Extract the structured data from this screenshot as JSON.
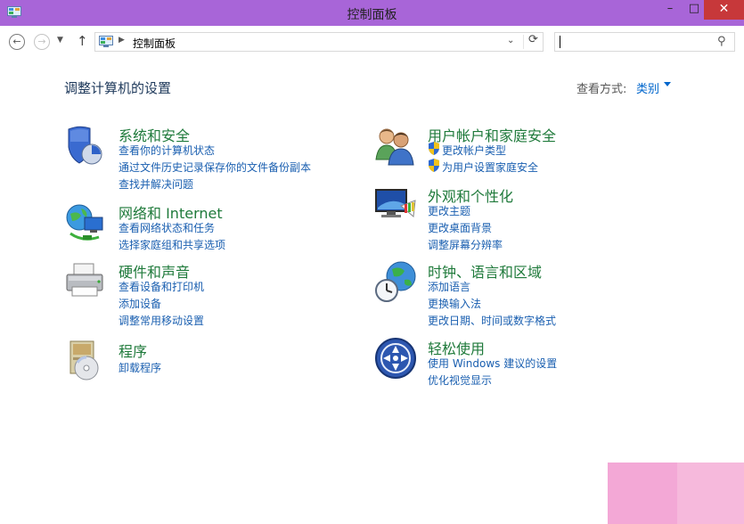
{
  "window": {
    "title": "控制面板"
  },
  "toolbar": {
    "address_path": "控制面板",
    "search_placeholder": ""
  },
  "main": {
    "heading": "调整计算机的设置",
    "view_by_label": "查看方式:",
    "view_by_value": "类别"
  },
  "categories": [
    {
      "title": "系统和安全",
      "icon": "shield-icon",
      "links": [
        "查看你的计算机状态",
        "通过文件历史记录保存你的文件备份副本",
        "查找并解决问题"
      ]
    },
    {
      "title": "网络和 Internet",
      "icon": "network-globe-icon",
      "links": [
        "查看网络状态和任务",
        "选择家庭组和共享选项"
      ]
    },
    {
      "title": "硬件和声音",
      "icon": "printer-icon",
      "links": [
        "查看设备和打印机",
        "添加设备",
        "调整常用移动设置"
      ]
    },
    {
      "title": "程序",
      "icon": "programs-disc-icon",
      "links": [
        "卸载程序"
      ]
    },
    {
      "title": "用户帐户和家庭安全",
      "icon": "users-icon",
      "links": [
        "更改帐户类型",
        "为用户设置家庭安全"
      ]
    },
    {
      "title": "外观和个性化",
      "icon": "monitor-palette-icon",
      "links": [
        "更改主题",
        "更改桌面背景",
        "调整屏幕分辨率"
      ]
    },
    {
      "title": "时钟、语言和区域",
      "icon": "clock-globe-icon",
      "links": [
        "添加语言",
        "更换输入法",
        "更改日期、时间或数字格式"
      ]
    },
    {
      "title": "轻松使用",
      "icon": "ease-of-access-icon",
      "links": [
        "使用 Windows 建议的设置",
        "优化视觉显示"
      ]
    }
  ],
  "colors": {
    "titlebar": "#a865d8",
    "category_title": "#1f7a3b",
    "link": "#1a5fb0",
    "close_button": "#c7383a"
  }
}
